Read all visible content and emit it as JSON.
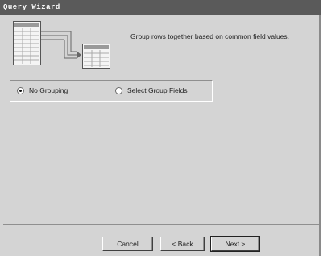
{
  "window": {
    "title": "Query Wizard"
  },
  "description": "Group rows together based on common field values.",
  "grouping": {
    "options": [
      {
        "label": "No Grouping",
        "selected": true
      },
      {
        "label": "Select Group Fields",
        "selected": false
      }
    ]
  },
  "buttons": {
    "cancel": "Cancel",
    "back": "< Back",
    "next": "Next >"
  },
  "colors": {
    "window_bg": "#d4d4d4",
    "titlebar_bg": "#5a5a5a"
  }
}
